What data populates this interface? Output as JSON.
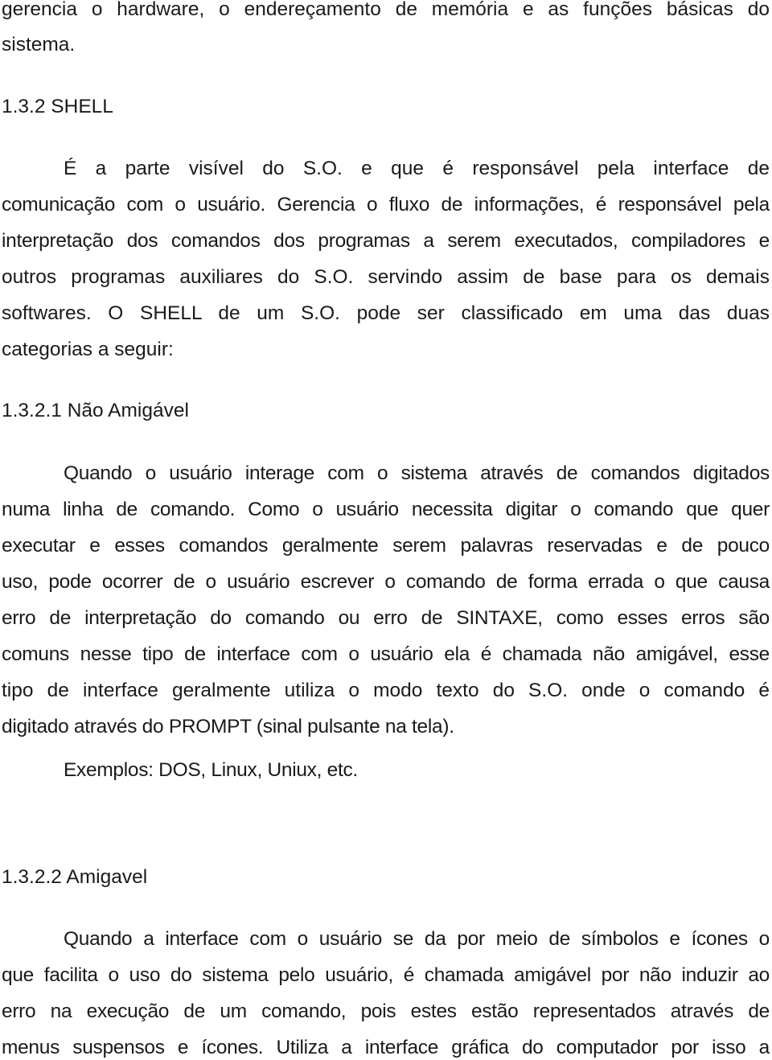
{
  "document": {
    "intro": {
      "lines": [
        "gerencia o hardware, o endereçamento de memória e as funções básicas do",
        "sistema."
      ]
    },
    "section_shell": {
      "heading": "1.3.2  SHELL",
      "paragraph_lines": [
        "É a parte visível do S.O. e que é responsável pela interface de",
        "comunicação com o usuário. Gerencia o fluxo de informações, é responsável pela",
        "interpretação dos comandos dos programas a serem executados, compiladores e",
        "outros programas auxiliares do S.O. servindo assim de base para os demais",
        "softwares. O SHELL de um S.O. pode ser classificado em uma das duas",
        "categorias a seguir:"
      ]
    },
    "section_nao_amigavel": {
      "heading": "1.3.2.1  Não Amigável",
      "paragraph_lines": [
        "Quando o usuário interage com o sistema através de comandos digitados",
        "numa linha de comando. Como o usuário necessita digitar o comando que quer",
        "executar e esses comandos geralmente serem palavras reservadas e de pouco",
        "uso, pode ocorrer de o usuário escrever o comando de forma errada o que causa",
        "erro de interpretação do comando ou erro de SINTAXE, como esses erros são",
        "comuns nesse tipo de interface com o usuário ela é chamada não amigável, esse",
        "tipo de interface geralmente utiliza o modo texto do S.O. onde o comando é",
        "digitado através do PROMPT (sinal pulsante na tela)."
      ],
      "examples": "Exemplos: DOS, Linux, Uniux, etc."
    },
    "section_amigavel": {
      "heading": "1.3.2.2  Amigavel",
      "paragraph_lines": [
        "Quando a interface com o usuário se da por meio de símbolos e ícones o",
        "que facilita o uso do sistema pelo usuário, é chamada amigável por não induzir ao",
        "erro na execução de um comando, pois estes estão representados através de",
        "menus suspensos e ícones. Utiliza a interface gráfica do computador por isso a"
      ]
    }
  }
}
